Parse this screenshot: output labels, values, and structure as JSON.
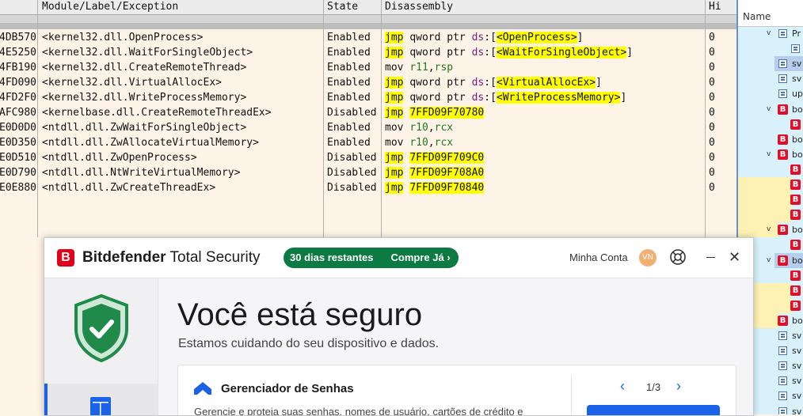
{
  "debugger": {
    "columns": {
      "label": "Module/Label/Exception",
      "state": "State",
      "disasm": "Disassembly",
      "hits": "Hi"
    },
    "rows": [
      {
        "addr": "4DB570",
        "label": "<kernel32.dll.OpenProcess>",
        "state": "Enabled",
        "op": "jmp",
        "rest_a": "qword ptr ",
        "seg": "ds",
        "rest_b": ":[",
        "target": "<OpenProcess>",
        "tail": "]",
        "hit": "0",
        "style": "ptr"
      },
      {
        "addr": "4E5250",
        "label": "<kernel32.dll.WaitForSingleObject>",
        "state": "Enabled",
        "op": "jmp",
        "rest_a": "qword ptr ",
        "seg": "ds",
        "rest_b": ":[",
        "target": "<WaitForSingleObject>",
        "tail": "]",
        "hit": "0",
        "style": "ptr"
      },
      {
        "addr": "4FB190",
        "label": "<kernel32.dll.CreateRemoteThread>",
        "state": "Enabled",
        "op": "mov",
        "r1": "r11",
        "comma": ",",
        "r2": "rsp",
        "hit": "0",
        "style": "mov"
      },
      {
        "addr": "4FD090",
        "label": "<kernel32.dll.VirtualAllocEx>",
        "state": "Enabled",
        "op": "jmp",
        "rest_a": "qword ptr ",
        "seg": "ds",
        "rest_b": ":[",
        "target": "<VirtualAllocEx>",
        "tail": "]",
        "hit": "0",
        "style": "ptr"
      },
      {
        "addr": "4FD2F0",
        "label": "<kernel32.dll.WriteProcessMemory>",
        "state": "Enabled",
        "op": "jmp",
        "rest_a": "qword ptr ",
        "seg": "ds",
        "rest_b": ":[",
        "target": "<WriteProcessMemory>",
        "tail": "]",
        "hit": "0",
        "style": "ptr"
      },
      {
        "addr": "AFC980",
        "label": "<kernelbase.dll.CreateRemoteThreadEx>",
        "state": "Disabled",
        "op": "jmp",
        "target": "7FFD09F70780",
        "hit": "0",
        "style": "addr"
      },
      {
        "addr": "E0D0D0",
        "label": "<ntdll.dll.ZwWaitForSingleObject>",
        "state": "Enabled",
        "op": "mov",
        "r1": "r10",
        "comma": ",",
        "r2": "rcx",
        "hit": "0",
        "style": "mov"
      },
      {
        "addr": "E0D350",
        "label": "<ntdll.dll.ZwAllocateVirtualMemory>",
        "state": "Enabled",
        "op": "mov",
        "r1": "r10",
        "comma": ",",
        "r2": "rcx",
        "hit": "0",
        "style": "mov"
      },
      {
        "addr": "E0D510",
        "label": "<ntdll.dll.ZwOpenProcess>",
        "state": "Disabled",
        "op": "jmp",
        "target": "7FFD09F709C0",
        "hit": "0",
        "style": "addr"
      },
      {
        "addr": "E0D790",
        "label": "<ntdll.dll.NtWriteVirtualMemory>",
        "state": "Disabled",
        "op": "jmp",
        "target": "7FFD09F708A0",
        "hit": "0",
        "style": "addr"
      },
      {
        "addr": "E0E880",
        "label": "<ntdll.dll.ZwCreateThreadEx>",
        "state": "Disabled",
        "op": "jmp",
        "target": "7FFD09F70840",
        "hit": "0",
        "style": "addr"
      }
    ]
  },
  "right_pane": {
    "header": "Name",
    "items": [
      {
        "kind": "folder",
        "text": "Pr",
        "chev": "v"
      },
      {
        "kind": "folder",
        "text": "",
        "chev": ""
      },
      {
        "kind": "folder",
        "text": "sv",
        "chev": ""
      },
      {
        "kind": "folder",
        "text": "sv",
        "chev": ""
      },
      {
        "kind": "folder",
        "text": "up",
        "chev": ""
      },
      {
        "kind": "b",
        "text": "bo",
        "chev": "v"
      },
      {
        "kind": "b",
        "text": "",
        "chev": ""
      },
      {
        "kind": "b",
        "text": "bo",
        "chev": ""
      },
      {
        "kind": "b",
        "text": "bo",
        "chev": "v"
      },
      {
        "kind": "b",
        "text": "",
        "chev": ""
      },
      {
        "kind": "b",
        "text": "",
        "chev": ""
      },
      {
        "kind": "b",
        "text": "",
        "chev": ""
      },
      {
        "kind": "b",
        "text": "",
        "chev": ""
      },
      {
        "kind": "b",
        "text": "bo",
        "chev": "v"
      },
      {
        "kind": "b",
        "text": "",
        "chev": ""
      },
      {
        "kind": "b",
        "text": "bo",
        "chev": "v"
      },
      {
        "kind": "b",
        "text": "",
        "chev": ""
      },
      {
        "kind": "b",
        "text": "",
        "chev": ""
      },
      {
        "kind": "b",
        "text": "",
        "chev": ""
      },
      {
        "kind": "b",
        "text": "bo",
        "chev": ""
      },
      {
        "kind": "folder",
        "text": "sv",
        "chev": ""
      },
      {
        "kind": "folder",
        "text": "sv",
        "chev": ""
      },
      {
        "kind": "folder",
        "text": "sv",
        "chev": ""
      },
      {
        "kind": "folder",
        "text": "sv",
        "chev": ""
      },
      {
        "kind": "folder",
        "text": "sv",
        "chev": ""
      },
      {
        "kind": "folder",
        "text": "sv",
        "chev": ""
      }
    ],
    "colors": {
      "selected": "#b6cdee",
      "highlight": "#fdf1b3",
      "background": "#d8f1fb"
    }
  },
  "bitdefender": {
    "logo_letter": "B",
    "brand_bold": "Bitdefender",
    "brand_rest": " Total Security",
    "trial_text": "30 dias restantes",
    "buy_text": "Compre Já ›",
    "account_label": "Minha Conta",
    "avatar_initials": "VN",
    "help_icon": "lifebuoy-icon",
    "close_glyph": "✕",
    "headline": "Você está seguro",
    "subheadline": "Estamos cuidando do seu dispositivo e dados.",
    "card": {
      "title": "Gerenciador de Senhas",
      "description": "Gerencie e proteja suas senhas, nomes de usuário, cartões de crédito e",
      "pager": "1/3",
      "prev": "‹",
      "next": "›"
    },
    "colors": {
      "brand_red": "#e2001a",
      "green": "#0c7a43",
      "blue": "#1a62e8",
      "shield_green": "#1f8a4a"
    }
  }
}
